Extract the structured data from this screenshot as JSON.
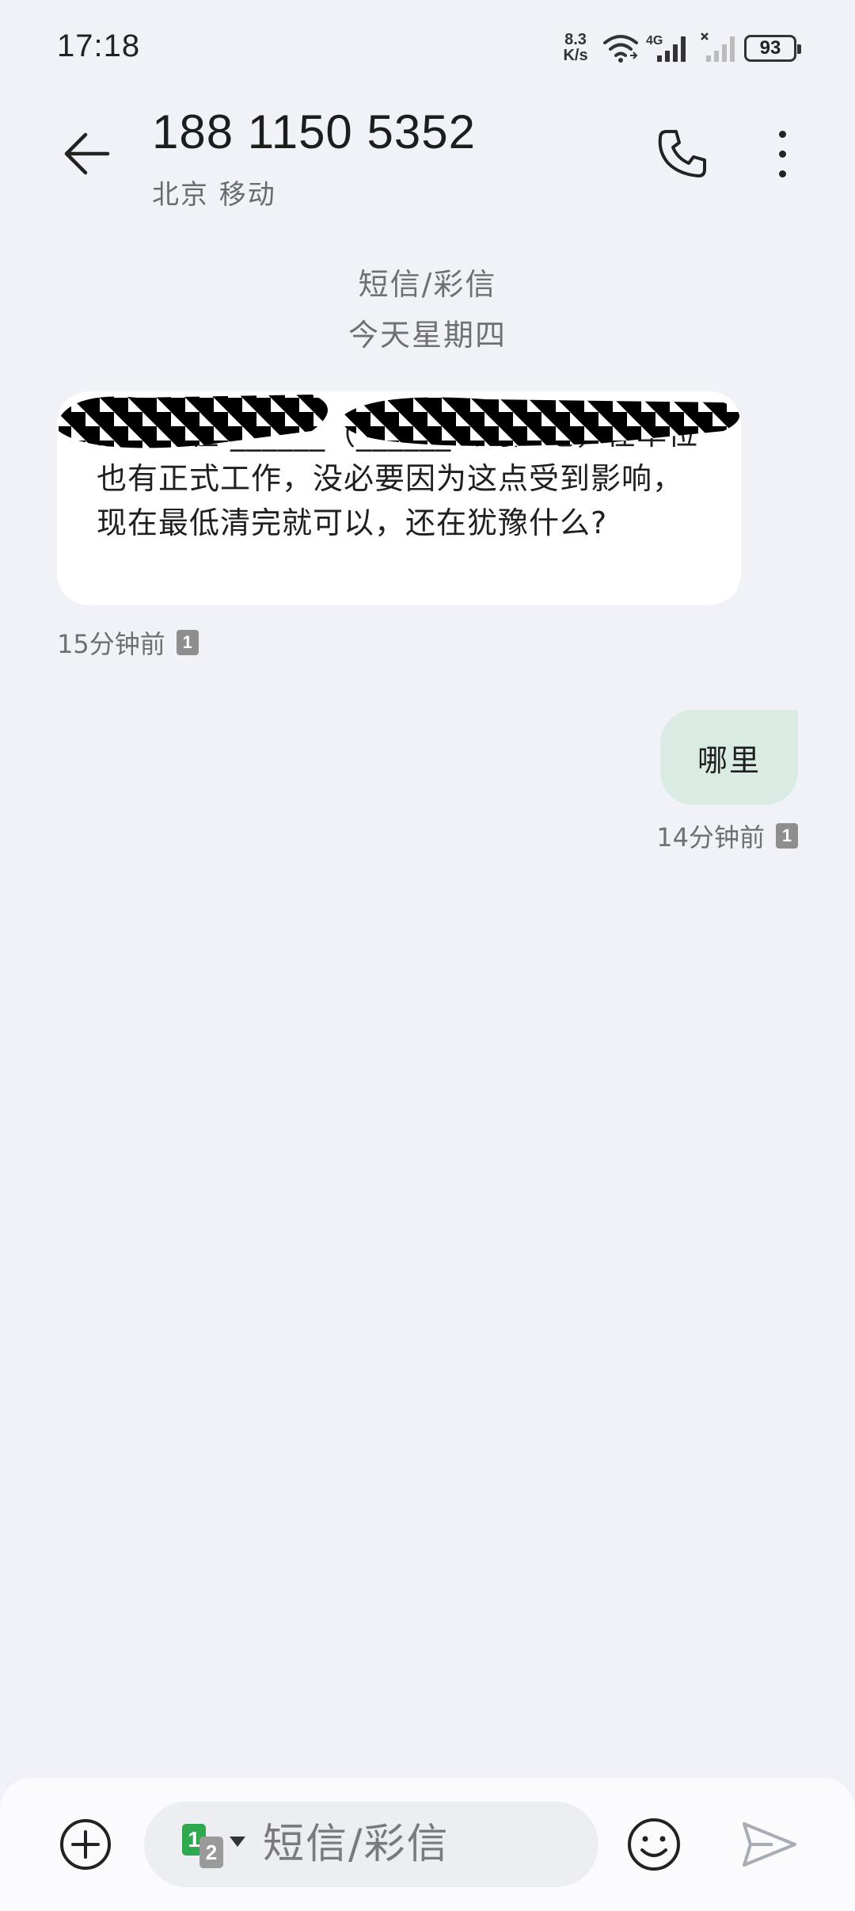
{
  "status_bar": {
    "time": "17:18",
    "net_speed_value": "8.3",
    "net_speed_unit": "K/s",
    "network_type": "4G",
    "battery_level": "93"
  },
  "header": {
    "contact_number": "188 1150 5352",
    "contact_location": "北京 移动"
  },
  "conversation": {
    "type_label": "短信/彩信",
    "date_label": "今天星期四"
  },
  "messages": [
    {
      "direction": "incoming",
      "text": "您好，在 ______（______公司）吧，在单位也有正式工作，没必要因为这点受到影响，现在最低清完就可以，还在犹豫什么?",
      "time": "15分钟前",
      "sim": "1"
    },
    {
      "direction": "outgoing",
      "text": "哪里",
      "time": "14分钟前",
      "sim": "1"
    }
  ],
  "compose": {
    "placeholder": "短信/彩信",
    "sim_primary": "1",
    "sim_secondary": "2"
  },
  "icons": {
    "back": "arrow-left-icon",
    "call": "phone-icon",
    "more": "more-vertical-icon",
    "add": "plus-circle-icon",
    "emoji": "smiley-icon",
    "send": "send-icon"
  }
}
